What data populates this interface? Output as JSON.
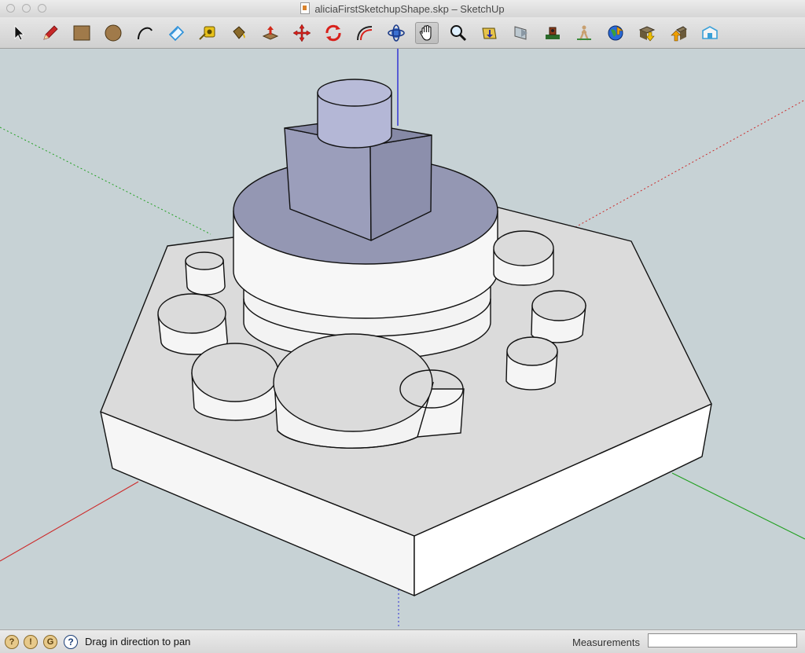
{
  "window": {
    "title": "aliciaFirstSketchupShape.skp – SketchUp",
    "buttons": [
      "close",
      "minimize",
      "zoom"
    ]
  },
  "toolbar": {
    "tools": [
      {
        "name": "select-tool",
        "icon": "arrow-icon"
      },
      {
        "name": "pencil-tool",
        "icon": "pencil-icon"
      },
      {
        "name": "rectangle-tool",
        "icon": "rectangle-icon"
      },
      {
        "name": "circle-tool",
        "icon": "circle-icon"
      },
      {
        "name": "arc-tool",
        "icon": "arc-icon"
      },
      {
        "name": "eraser-tool",
        "icon": "eraser-icon"
      },
      {
        "name": "tape-measure-tool",
        "icon": "tape-measure-icon"
      },
      {
        "name": "paint-bucket-tool",
        "icon": "paint-bucket-icon"
      },
      {
        "name": "push-pull-tool",
        "icon": "push-pull-icon"
      },
      {
        "name": "move-tool",
        "icon": "move-icon"
      },
      {
        "name": "rotate-tool",
        "icon": "rotate-icon"
      },
      {
        "name": "offset-tool",
        "icon": "offset-icon"
      },
      {
        "name": "orbit-tool",
        "icon": "orbit-icon"
      },
      {
        "name": "pan-tool",
        "icon": "hand-icon",
        "active": true
      },
      {
        "name": "zoom-tool",
        "icon": "magnifier-icon"
      },
      {
        "name": "zoom-extents-tool",
        "icon": "zoom-extents-icon"
      },
      {
        "name": "previous-view-tool",
        "icon": "previous-view-icon"
      },
      {
        "name": "position-camera-tool",
        "icon": "position-camera-icon"
      },
      {
        "name": "walk-tool",
        "icon": "walk-icon"
      },
      {
        "name": "add-location-tool",
        "icon": "globe-icon"
      },
      {
        "name": "get-models-tool",
        "icon": "get-models-icon"
      },
      {
        "name": "share-model-tool",
        "icon": "share-model-icon"
      },
      {
        "name": "extension-warehouse-tool",
        "icon": "extension-warehouse-icon"
      }
    ]
  },
  "colors": {
    "sky": "#c7d2d5",
    "face_white": "#e8e8e8",
    "face_side": "#f6f6f6",
    "face_blue": "#9497b3",
    "axis_red": "#cc2a2a",
    "axis_green": "#22a022",
    "axis_blue": "#2a2ad4"
  },
  "statusbar": {
    "icons": [
      "geo-location-icon",
      "credits-icon",
      "google-icon",
      "help-icon"
    ],
    "message": "Drag in direction to pan",
    "measurements_label": "Measurements",
    "measurements_value": ""
  }
}
